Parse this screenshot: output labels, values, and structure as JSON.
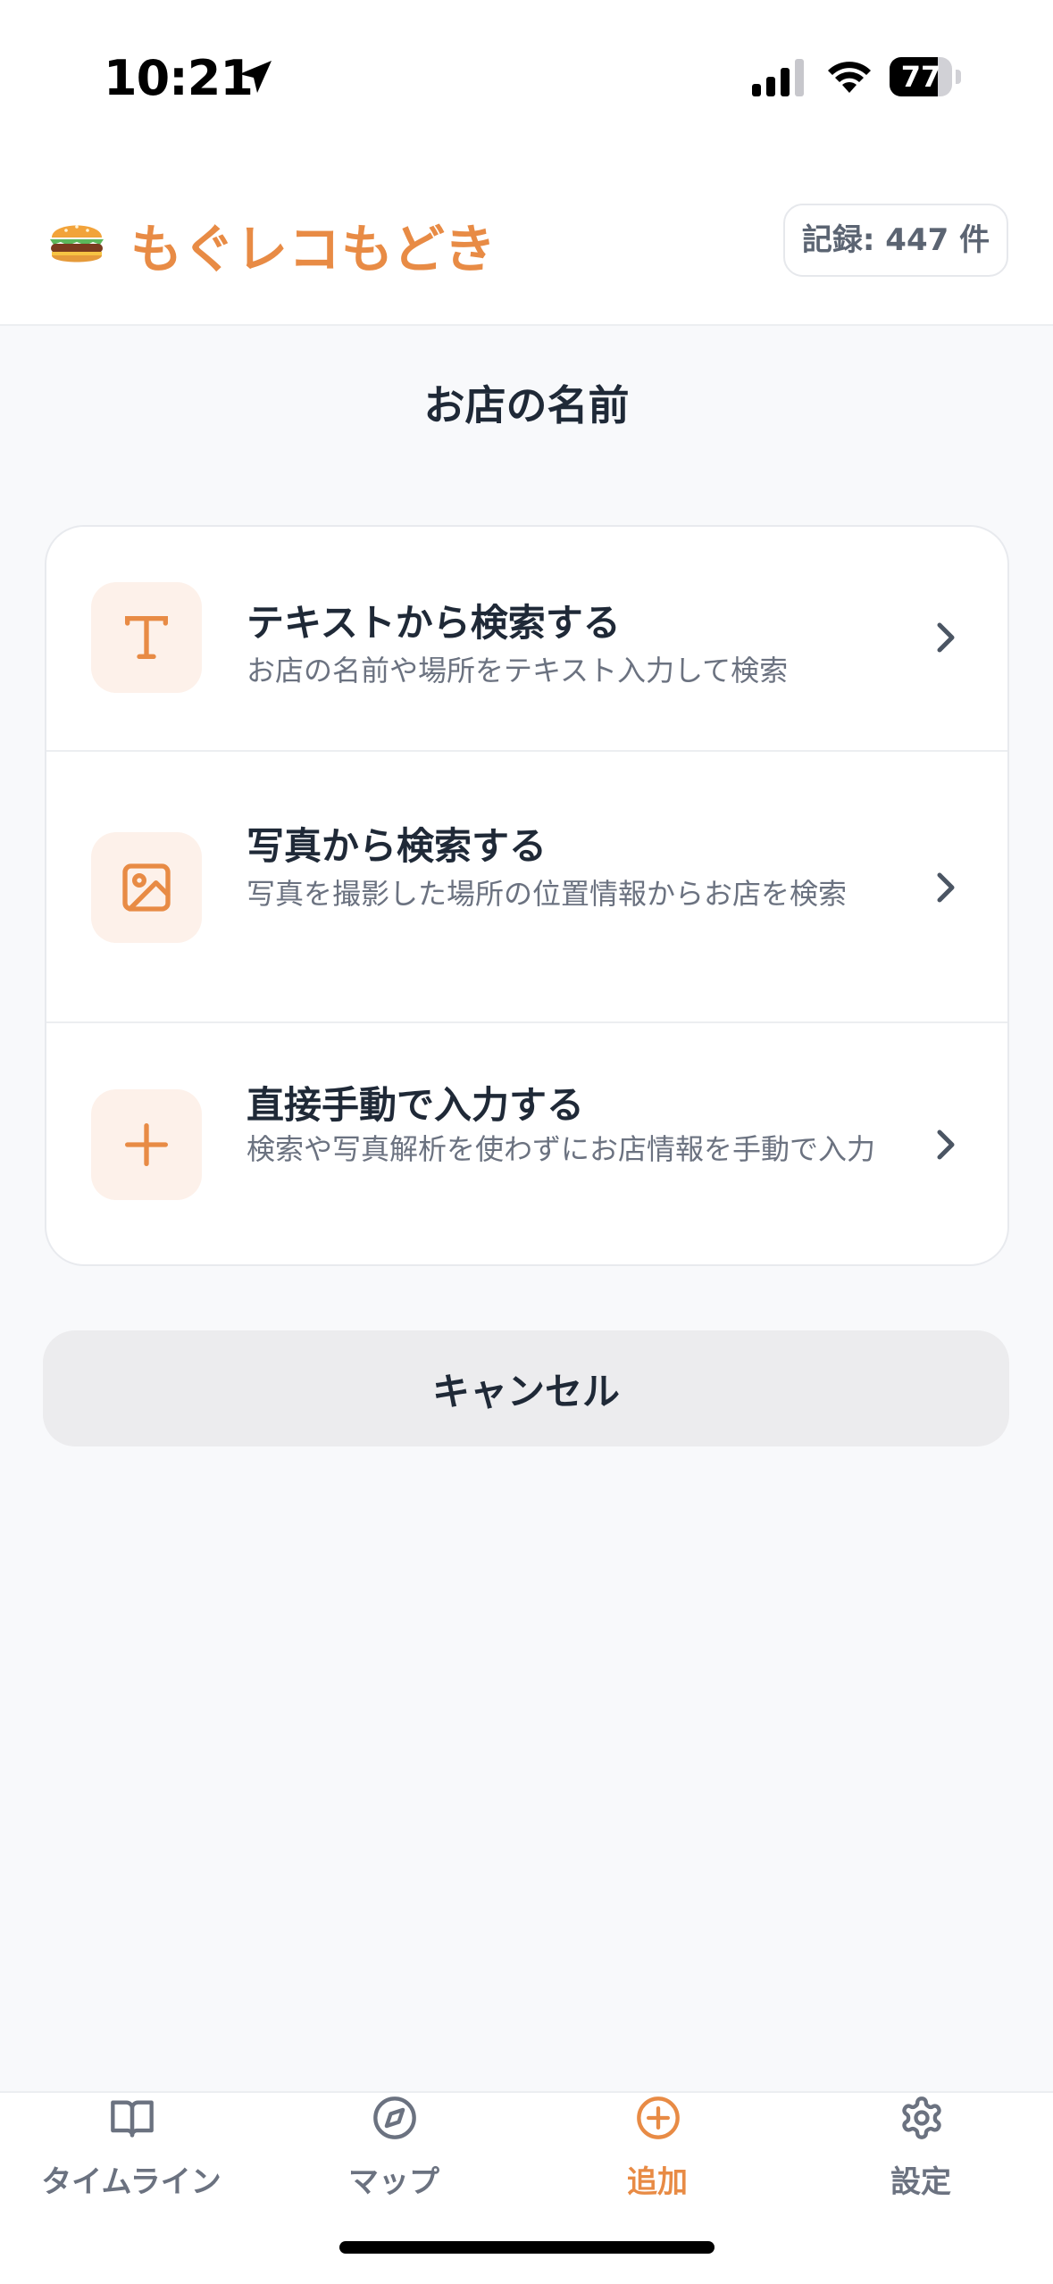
{
  "status_bar": {
    "time": "10:21",
    "battery_level": "77",
    "battery_fraction": 0.77
  },
  "header": {
    "logo_emoji": "🍔",
    "title": "もぐレコもどき",
    "record_count": "記録: 447 件"
  },
  "section_title": "お店の名前",
  "options": [
    {
      "icon": "text-t-icon",
      "title": "テキストから検索する",
      "description": "お店の名前や場所をテキスト入力して検索"
    },
    {
      "icon": "image-icon",
      "title": "写真から検索する",
      "description": "写真を撮影した場所の位置情報からお店を検索"
    },
    {
      "icon": "plus-icon",
      "title": "直接手動で入力する",
      "description": "検索や写真解析を使わずにお店情報を手動で入力"
    }
  ],
  "cancel_label": "キャンセル",
  "tabs": [
    {
      "label": "タイムライン",
      "icon": "book-open-icon",
      "active": false
    },
    {
      "label": "マップ",
      "icon": "compass-icon",
      "active": false
    },
    {
      "label": "追加",
      "icon": "plus-circle-icon",
      "active": true
    },
    {
      "label": "設定",
      "icon": "gear-icon",
      "active": false
    }
  ],
  "colors": {
    "accent": "#e88b45",
    "icon_bg": "#fdf1ea",
    "text_primary": "#1f2937",
    "text_secondary": "#6b7280",
    "background": "#f8f9fb"
  }
}
